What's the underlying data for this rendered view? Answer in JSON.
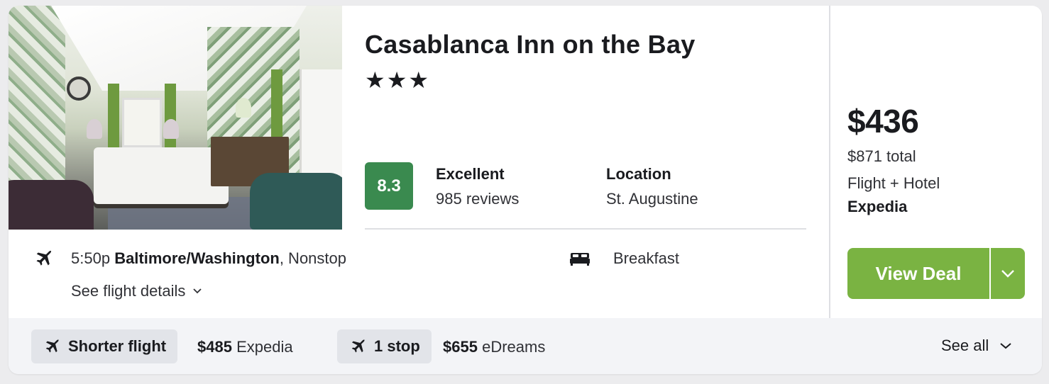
{
  "hotel": {
    "name": "Casablanca Inn on the Bay",
    "stars": "★★★",
    "score": "8.3",
    "rating_word": "Excellent",
    "reviews": "985 reviews",
    "location_label": "Location",
    "location_value": "St. Augustine",
    "amenity": "Breakfast"
  },
  "flight": {
    "time": "5:50p",
    "airport": "Baltimore/Washington",
    "stops": ", Nonstop",
    "details_link": "See flight details"
  },
  "deal": {
    "price": "$436",
    "total": "$871 total",
    "package": "Flight + Hotel",
    "provider": "Expedia",
    "button_label": "View Deal"
  },
  "alternatives": [
    {
      "chip": "Shorter flight",
      "price": "$485",
      "provider": "Expedia"
    },
    {
      "chip": "1 stop",
      "price": "$655",
      "provider": "eDreams"
    }
  ],
  "footer": {
    "see_all": "See all"
  },
  "colors": {
    "score_bg": "#3a8a4f",
    "button_bg": "#7ab342",
    "footer_bg": "#f3f4f7"
  },
  "icons": [
    "plane-icon",
    "bed-icon",
    "chevron-down-icon"
  ]
}
